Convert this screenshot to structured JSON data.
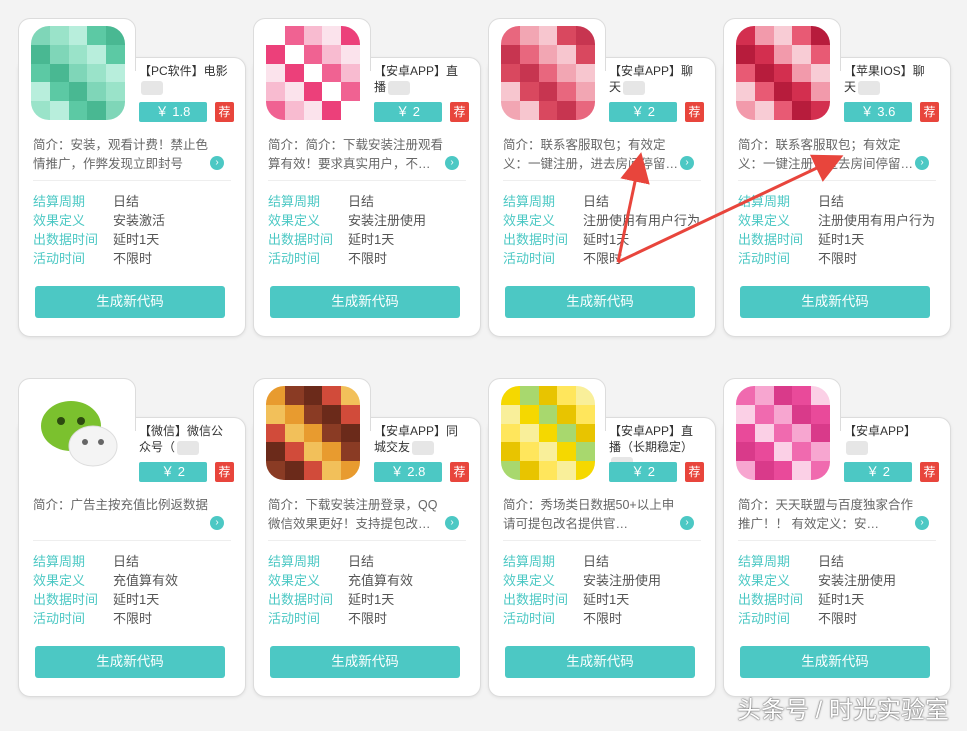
{
  "colors": {
    "accent": "#4cc8c4",
    "tag_red": "#e8453c",
    "arrow": "#e8453c"
  },
  "labels": {
    "cycle": "结算周期",
    "effect": "效果定义",
    "data_time": "出数据时间",
    "active_time": "活动时间",
    "button": "生成新代码",
    "tag": "荐"
  },
  "cards": [
    {
      "title": "【PC软件】电影",
      "price": "￥ 1.8",
      "intro": "简介：安装，观看计费！禁止色情推广，作弊发现立即封号",
      "cycle": "日结",
      "effect": "安装激活",
      "data_time": "延时1天",
      "active_time": "不限时",
      "icon": "pc-app-icon"
    },
    {
      "title": "【安卓APP】直播",
      "price": "￥ 2",
      "intro": "简介：简介：下载安装注册观看算有效！要求真实用户，不…",
      "cycle": "日结",
      "effect": "安装注册使用",
      "data_time": "延时1天",
      "active_time": "不限时",
      "icon": "live-app-icon"
    },
    {
      "title": "【安卓APP】聊天",
      "price": "￥ 2",
      "intro": "简介：联系客服取包；有效定义：一键注册，进去房间停留…",
      "cycle": "日结",
      "effect": "注册使用有用户行为",
      "data_time": "延时1天",
      "active_time": "不限时",
      "icon": "chat-app-icon"
    },
    {
      "title": "【苹果IOS】聊天",
      "price": "￥ 3.6",
      "intro": "简介：联系客服取包；有效定义：一键注册，进去房间停留…",
      "cycle": "日结",
      "effect": "注册使用有用户行为",
      "data_time": "延时1天",
      "active_time": "不限时",
      "icon": "ios-chat-app-icon"
    },
    {
      "title": "【微信】微信公众号（",
      "price": "￥ 2",
      "intro": "简介：广告主按充值比例返数据",
      "cycle": "日结",
      "effect": "充值算有效",
      "data_time": "延时1天",
      "active_time": "不限时",
      "icon": "wechat-icon"
    },
    {
      "title": "【安卓APP】同城交友",
      "price": "￥ 2.8",
      "intro": "简介：下载安装注册登录，QQ微信效果更好！支持提包改…",
      "cycle": "日结",
      "effect": "充值算有效",
      "data_time": "延时1天",
      "active_time": "不限时",
      "icon": "dating-app-icon"
    },
    {
      "title": "【安卓APP】直播（长期稳定）",
      "price": "￥ 2",
      "intro": "简介：秀场类日数据50+以上申请可提包改名提供官…",
      "cycle": "日结",
      "effect": "安装注册使用",
      "data_time": "延时1天",
      "active_time": "不限时",
      "icon": "show-app-icon"
    },
    {
      "title": "【安卓APP】",
      "price": "￥ 2",
      "intro": "简介：天天联盟与百度独家合作推广！！ 有效定义：安…",
      "cycle": "日结",
      "effect": "安装注册使用",
      "data_time": "延时1天",
      "active_time": "不限时",
      "icon": "union-app-icon"
    }
  ],
  "watermark": "头条号 / 时光实验室"
}
